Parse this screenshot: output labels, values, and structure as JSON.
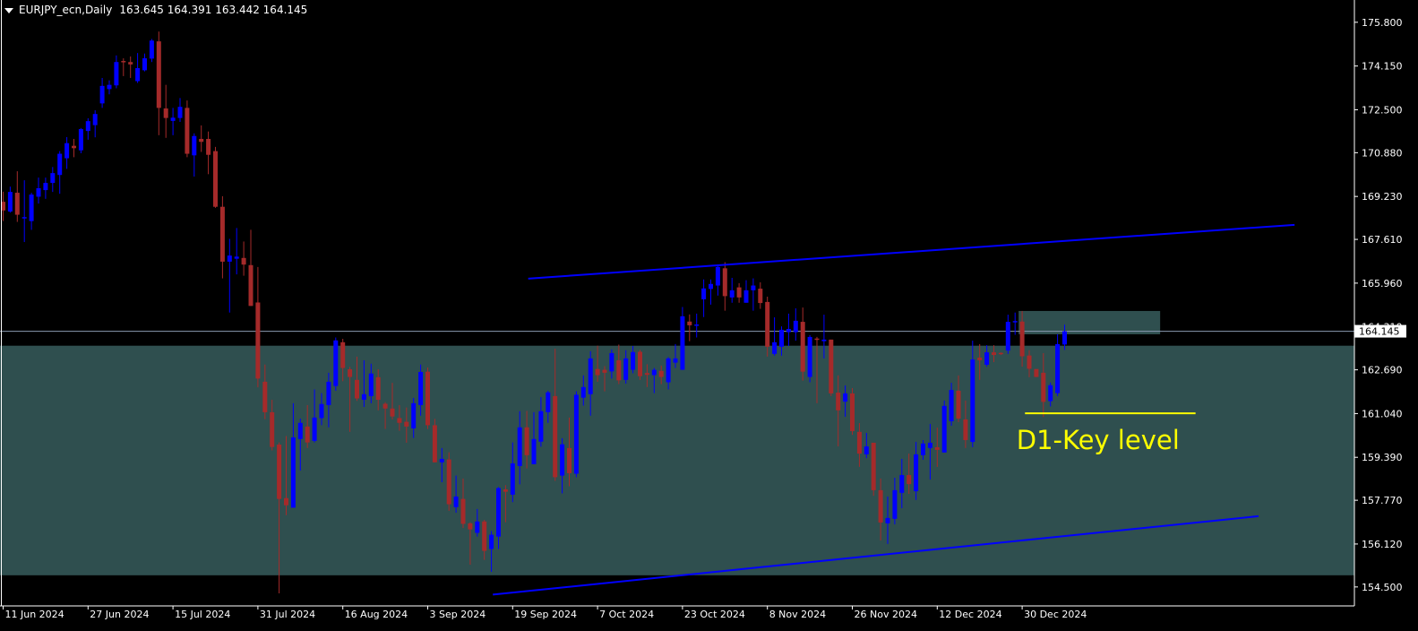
{
  "header": {
    "symbol_timeframe": "EURJPY_ecn,Daily",
    "open": "163.645",
    "high": "164.391",
    "low": "163.442",
    "close": "164.145"
  },
  "colors": {
    "background": "#000000",
    "bull": "#0000ff",
    "bear": "#a52a2a",
    "zone": "#2f4f4f",
    "trendline": "#0000ff",
    "price_line": "#8a9ab0",
    "key_level": "#ffff00",
    "axis": "#ffffff"
  },
  "chart_data": {
    "type": "candlestick",
    "title": "EURJPY_ecn,Daily",
    "ylim": [
      153.92,
      176.64
    ],
    "yticks": [
      "175.800",
      "174.150",
      "172.500",
      "170.880",
      "169.230",
      "167.610",
      "165.960",
      "164.310",
      "162.690",
      "161.040",
      "159.390",
      "157.770",
      "156.120",
      "154.500"
    ],
    "xticks": [
      {
        "label": "11 Jun 2024",
        "bar": 0
      },
      {
        "label": "27 Jun 2024",
        "bar": 12
      },
      {
        "label": "15 Jul 2024",
        "bar": 24
      },
      {
        "label": "31 Jul 2024",
        "bar": 36
      },
      {
        "label": "16 Aug 2024",
        "bar": 48
      },
      {
        "label": "3 Sep 2024",
        "bar": 60
      },
      {
        "label": "19 Sep 2024",
        "bar": 72
      },
      {
        "label": "7 Oct 2024",
        "bar": 84
      },
      {
        "label": "23 Oct 2024",
        "bar": 96
      },
      {
        "label": "8 Nov 2024",
        "bar": 108
      },
      {
        "label": "26 Nov 2024",
        "bar": 120
      },
      {
        "label": "12 Dec 2024",
        "bar": 132
      },
      {
        "label": "30 Dec 2024",
        "bar": 144
      }
    ],
    "current_price": "164.145",
    "ohlc": [
      [
        169.03,
        169.41,
        168.3,
        168.7
      ],
      [
        168.66,
        169.6,
        168.62,
        169.4
      ],
      [
        169.37,
        170.18,
        168.27,
        168.54
      ],
      [
        168.43,
        169.84,
        167.51,
        168.45
      ],
      [
        168.3,
        169.37,
        167.97,
        169.3
      ],
      [
        169.22,
        169.94,
        168.96,
        169.54
      ],
      [
        169.47,
        169.94,
        169.14,
        169.74
      ],
      [
        169.74,
        170.34,
        169.4,
        170.11
      ],
      [
        170.04,
        170.94,
        169.33,
        170.84
      ],
      [
        170.67,
        171.47,
        170.27,
        171.24
      ],
      [
        171.14,
        171.4,
        170.71,
        171.05
      ],
      [
        170.97,
        171.81,
        170.86,
        171.77
      ],
      [
        171.7,
        172.18,
        171.37,
        172.07
      ],
      [
        171.92,
        172.48,
        171.46,
        172.34
      ],
      [
        172.74,
        173.7,
        172.57,
        173.4
      ],
      [
        173.28,
        173.61,
        173.08,
        173.44
      ],
      [
        173.42,
        174.55,
        173.31,
        174.3
      ],
      [
        174.34,
        174.44,
        173.77,
        174.29
      ],
      [
        174.3,
        174.51,
        173.7,
        174.21
      ],
      [
        173.58,
        174.64,
        173.51,
        174.07
      ],
      [
        173.99,
        174.62,
        173.95,
        174.44
      ],
      [
        174.43,
        175.17,
        174.3,
        175.11
      ],
      [
        175.08,
        175.45,
        171.54,
        172.57
      ],
      [
        172.55,
        173.44,
        171.44,
        172.19
      ],
      [
        172.08,
        172.57,
        171.54,
        172.2
      ],
      [
        172.19,
        172.94,
        172.04,
        172.61
      ],
      [
        172.57,
        172.85,
        170.71,
        170.84
      ],
      [
        170.78,
        171.61,
        169.98,
        171.51
      ],
      [
        171.4,
        171.91,
        170.91,
        171.29
      ],
      [
        171.4,
        171.68,
        170.07,
        170.8
      ],
      [
        170.94,
        171.1,
        168.8,
        168.84
      ],
      [
        168.84,
        169.24,
        166.14,
        166.77
      ],
      [
        166.77,
        167.63,
        164.85,
        167.0
      ],
      [
        166.88,
        168.04,
        166.29,
        166.96
      ],
      [
        166.91,
        167.53,
        166.24,
        166.66
      ],
      [
        166.64,
        167.97,
        165.1,
        165.1
      ],
      [
        165.23,
        166.57,
        162.03,
        162.36
      ],
      [
        162.24,
        162.89,
        160.83,
        161.09
      ],
      [
        161.09,
        161.56,
        159.65,
        159.78
      ],
      [
        159.87,
        159.95,
        154.26,
        157.82
      ],
      [
        157.85,
        160.19,
        157.21,
        157.58
      ],
      [
        157.49,
        161.43,
        157.49,
        160.14
      ],
      [
        160.08,
        160.85,
        158.89,
        160.69
      ],
      [
        160.55,
        161.36,
        159.74,
        159.95
      ],
      [
        160.01,
        161.95,
        159.95,
        160.89
      ],
      [
        160.87,
        161.81,
        160.6,
        161.4
      ],
      [
        161.36,
        162.58,
        160.52,
        162.24
      ],
      [
        162.08,
        163.91,
        161.9,
        163.8
      ],
      [
        163.73,
        163.86,
        162.26,
        162.76
      ],
      [
        162.71,
        162.8,
        160.35,
        162.42
      ],
      [
        162.31,
        163.19,
        161.52,
        161.61
      ],
      [
        161.56,
        163.05,
        161.29,
        161.77
      ],
      [
        161.7,
        162.92,
        161.43,
        162.55
      ],
      [
        162.41,
        162.71,
        161.16,
        161.56
      ],
      [
        161.41,
        161.47,
        160.46,
        161.23
      ],
      [
        161.23,
        162.2,
        160.82,
        160.93
      ],
      [
        160.87,
        161.36,
        160.39,
        160.69
      ],
      [
        160.73,
        161.27,
        159.94,
        160.55
      ],
      [
        160.48,
        161.63,
        160.12,
        161.43
      ],
      [
        161.36,
        162.89,
        160.96,
        162.61
      ],
      [
        162.62,
        162.78,
        160.46,
        160.6
      ],
      [
        160.6,
        160.84,
        159.2,
        159.2
      ],
      [
        159.2,
        159.74,
        158.45,
        159.33
      ],
      [
        159.31,
        159.58,
        157.37,
        157.62
      ],
      [
        157.51,
        158.7,
        157.3,
        157.91
      ],
      [
        157.82,
        158.59,
        156.72,
        156.88
      ],
      [
        156.9,
        156.94,
        155.34,
        156.67
      ],
      [
        156.54,
        157.44,
        156.4,
        156.97
      ],
      [
        156.97,
        157.03,
        155.52,
        155.86
      ],
      [
        155.93,
        156.61,
        155.07,
        156.47
      ],
      [
        156.4,
        158.27,
        155.93,
        158.23
      ],
      [
        158.18,
        158.34,
        156.94,
        158.09
      ],
      [
        157.98,
        159.95,
        157.7,
        159.16
      ],
      [
        159.06,
        161.13,
        158.37,
        160.52
      ],
      [
        160.52,
        161.14,
        158.97,
        159.47
      ],
      [
        159.13,
        161.09,
        159.13,
        160.08
      ],
      [
        159.98,
        161.66,
        159.79,
        161.13
      ],
      [
        161.09,
        161.9,
        160.69,
        161.84
      ],
      [
        161.7,
        163.49,
        158.5,
        158.64
      ],
      [
        158.7,
        160.11,
        158.03,
        159.88
      ],
      [
        159.74,
        160.89,
        158.3,
        158.79
      ],
      [
        158.77,
        161.88,
        158.64,
        161.75
      ],
      [
        161.64,
        162.48,
        161.34,
        162.04
      ],
      [
        161.77,
        163.39,
        160.96,
        163.12
      ],
      [
        162.72,
        163.6,
        162.24,
        162.49
      ],
      [
        162.69,
        162.83,
        161.88,
        162.58
      ],
      [
        162.63,
        163.46,
        162.36,
        163.32
      ],
      [
        163.05,
        163.64,
        162.15,
        162.29
      ],
      [
        162.31,
        163.43,
        162.17,
        163.12
      ],
      [
        162.69,
        163.59,
        162.56,
        163.36
      ],
      [
        163.37,
        163.44,
        162.31,
        162.45
      ],
      [
        162.57,
        162.9,
        162.04,
        162.5
      ],
      [
        162.49,
        162.76,
        161.81,
        162.69
      ],
      [
        162.65,
        162.85,
        162.15,
        162.42
      ],
      [
        162.22,
        163.17,
        161.95,
        163.12
      ],
      [
        162.96,
        163.66,
        162.76,
        163.12
      ],
      [
        162.69,
        165.06,
        162.69,
        164.71
      ],
      [
        164.51,
        164.78,
        163.77,
        164.37
      ],
      [
        164.35,
        164.81,
        163.91,
        164.4
      ],
      [
        165.35,
        166.1,
        164.68,
        165.76
      ],
      [
        165.74,
        166.1,
        165.15,
        165.93
      ],
      [
        165.87,
        166.64,
        165.49,
        166.57
      ],
      [
        166.52,
        166.75,
        164.92,
        165.47
      ],
      [
        165.42,
        166.16,
        165.22,
        165.69
      ],
      [
        165.8,
        165.96,
        165.22,
        165.42
      ],
      [
        165.22,
        166.07,
        165.22,
        165.69
      ],
      [
        165.69,
        166.14,
        164.92,
        165.87
      ],
      [
        165.75,
        165.99,
        164.99,
        165.21
      ],
      [
        165.25,
        165.45,
        163.19,
        163.56
      ],
      [
        163.29,
        164.67,
        163.22,
        163.73
      ],
      [
        163.56,
        164.33,
        163.22,
        164.2
      ],
      [
        164.11,
        164.81,
        163.59,
        164.23
      ],
      [
        164.11,
        165.01,
        163.79,
        164.54
      ],
      [
        164.5,
        165.04,
        162.28,
        162.62
      ],
      [
        162.42,
        164.0,
        162.22,
        163.93
      ],
      [
        163.87,
        163.93,
        161.43,
        163.83
      ],
      [
        163.77,
        164.77,
        163.12,
        163.83
      ],
      [
        163.83,
        163.83,
        161.7,
        161.8
      ],
      [
        161.83,
        162.48,
        159.8,
        161.16
      ],
      [
        161.49,
        162.1,
        160.92,
        161.8
      ],
      [
        161.8,
        162.0,
        160.24,
        160.38
      ],
      [
        160.35,
        160.68,
        159.03,
        159.53
      ],
      [
        159.5,
        160.31,
        159.36,
        159.8
      ],
      [
        159.94,
        159.94,
        157.94,
        158.15
      ],
      [
        158.15,
        158.59,
        156.25,
        156.93
      ],
      [
        156.9,
        157.91,
        156.12,
        157.1
      ],
      [
        157.07,
        158.62,
        156.86,
        158.15
      ],
      [
        158.05,
        159.33,
        157.47,
        158.72
      ],
      [
        158.72,
        159.53,
        158.01,
        158.38
      ],
      [
        158.11,
        159.97,
        157.78,
        159.5
      ],
      [
        159.47,
        160.04,
        159.3,
        159.91
      ],
      [
        159.74,
        160.65,
        158.55,
        159.94
      ],
      [
        159.77,
        160.51,
        159.03,
        159.67
      ],
      [
        159.57,
        161.53,
        159.57,
        161.33
      ],
      [
        160.75,
        162.2,
        160.58,
        161.93
      ],
      [
        161.9,
        162.48,
        160.72,
        160.85
      ],
      [
        160.82,
        161.53,
        159.74,
        160.04
      ],
      [
        159.97,
        163.79,
        159.77,
        163.08
      ],
      [
        163.15,
        163.66,
        162.31,
        163.05
      ],
      [
        162.88,
        163.62,
        162.81,
        163.35
      ],
      [
        163.35,
        163.62,
        162.98,
        163.25
      ],
      [
        163.33,
        163.35,
        163.25,
        163.3
      ],
      [
        163.42,
        164.77,
        163.29,
        164.5
      ],
      [
        164.49,
        164.85,
        164.01,
        164.53
      ],
      [
        164.51,
        164.91,
        162.81,
        163.2
      ],
      [
        163.23,
        163.43,
        162.41,
        162.73
      ],
      [
        162.72,
        162.72,
        162.42,
        162.42
      ],
      [
        162.58,
        163.32,
        160.91,
        161.48
      ],
      [
        161.51,
        162.21,
        161.31,
        162.11
      ],
      [
        161.81,
        164.03,
        161.7,
        163.66
      ],
      [
        163.645,
        164.391,
        163.442,
        164.145
      ]
    ],
    "zones": [
      {
        "name": "main-zone",
        "price_top": 163.6,
        "price_bottom": 154.94,
        "bar_start": -1,
        "bar_end": null
      },
      {
        "name": "small-zone",
        "price_top": 164.91,
        "price_bottom": 164.03,
        "bar_start": 143.5,
        "bar_end": 163.5
      }
    ],
    "trendlines": [
      {
        "name": "upper-trendline",
        "bar1": 74.2,
        "price1": 166.13,
        "bar2": 182.5,
        "price2": 168.16
      },
      {
        "name": "lower-trendline",
        "bar1": 69.2,
        "price1": 154.21,
        "bar2": 177.4,
        "price2": 157.17
      }
    ],
    "key_level": {
      "label": "D1-Key level",
      "price": 161.05,
      "bar_start": 144.4,
      "bar_end": 168.5,
      "label_bar": 143.2,
      "label_price": 159.7
    }
  }
}
